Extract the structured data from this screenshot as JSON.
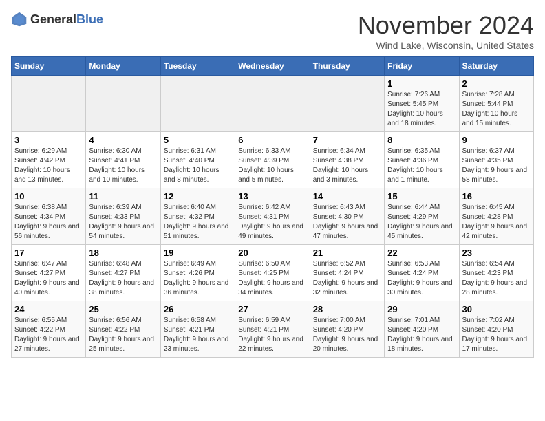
{
  "logo": {
    "text_general": "General",
    "text_blue": "Blue"
  },
  "title": "November 2024",
  "location": "Wind Lake, Wisconsin, United States",
  "days_header": [
    "Sunday",
    "Monday",
    "Tuesday",
    "Wednesday",
    "Thursday",
    "Friday",
    "Saturday"
  ],
  "weeks": [
    [
      {
        "day": "",
        "info": ""
      },
      {
        "day": "",
        "info": ""
      },
      {
        "day": "",
        "info": ""
      },
      {
        "day": "",
        "info": ""
      },
      {
        "day": "",
        "info": ""
      },
      {
        "day": "1",
        "info": "Sunrise: 7:26 AM\nSunset: 5:45 PM\nDaylight: 10 hours and 18 minutes."
      },
      {
        "day": "2",
        "info": "Sunrise: 7:28 AM\nSunset: 5:44 PM\nDaylight: 10 hours and 15 minutes."
      }
    ],
    [
      {
        "day": "3",
        "info": "Sunrise: 6:29 AM\nSunset: 4:42 PM\nDaylight: 10 hours and 13 minutes."
      },
      {
        "day": "4",
        "info": "Sunrise: 6:30 AM\nSunset: 4:41 PM\nDaylight: 10 hours and 10 minutes."
      },
      {
        "day": "5",
        "info": "Sunrise: 6:31 AM\nSunset: 4:40 PM\nDaylight: 10 hours and 8 minutes."
      },
      {
        "day": "6",
        "info": "Sunrise: 6:33 AM\nSunset: 4:39 PM\nDaylight: 10 hours and 5 minutes."
      },
      {
        "day": "7",
        "info": "Sunrise: 6:34 AM\nSunset: 4:38 PM\nDaylight: 10 hours and 3 minutes."
      },
      {
        "day": "8",
        "info": "Sunrise: 6:35 AM\nSunset: 4:36 PM\nDaylight: 10 hours and 1 minute."
      },
      {
        "day": "9",
        "info": "Sunrise: 6:37 AM\nSunset: 4:35 PM\nDaylight: 9 hours and 58 minutes."
      }
    ],
    [
      {
        "day": "10",
        "info": "Sunrise: 6:38 AM\nSunset: 4:34 PM\nDaylight: 9 hours and 56 minutes."
      },
      {
        "day": "11",
        "info": "Sunrise: 6:39 AM\nSunset: 4:33 PM\nDaylight: 9 hours and 54 minutes."
      },
      {
        "day": "12",
        "info": "Sunrise: 6:40 AM\nSunset: 4:32 PM\nDaylight: 9 hours and 51 minutes."
      },
      {
        "day": "13",
        "info": "Sunrise: 6:42 AM\nSunset: 4:31 PM\nDaylight: 9 hours and 49 minutes."
      },
      {
        "day": "14",
        "info": "Sunrise: 6:43 AM\nSunset: 4:30 PM\nDaylight: 9 hours and 47 minutes."
      },
      {
        "day": "15",
        "info": "Sunrise: 6:44 AM\nSunset: 4:29 PM\nDaylight: 9 hours and 45 minutes."
      },
      {
        "day": "16",
        "info": "Sunrise: 6:45 AM\nSunset: 4:28 PM\nDaylight: 9 hours and 42 minutes."
      }
    ],
    [
      {
        "day": "17",
        "info": "Sunrise: 6:47 AM\nSunset: 4:27 PM\nDaylight: 9 hours and 40 minutes."
      },
      {
        "day": "18",
        "info": "Sunrise: 6:48 AM\nSunset: 4:27 PM\nDaylight: 9 hours and 38 minutes."
      },
      {
        "day": "19",
        "info": "Sunrise: 6:49 AM\nSunset: 4:26 PM\nDaylight: 9 hours and 36 minutes."
      },
      {
        "day": "20",
        "info": "Sunrise: 6:50 AM\nSunset: 4:25 PM\nDaylight: 9 hours and 34 minutes."
      },
      {
        "day": "21",
        "info": "Sunrise: 6:52 AM\nSunset: 4:24 PM\nDaylight: 9 hours and 32 minutes."
      },
      {
        "day": "22",
        "info": "Sunrise: 6:53 AM\nSunset: 4:24 PM\nDaylight: 9 hours and 30 minutes."
      },
      {
        "day": "23",
        "info": "Sunrise: 6:54 AM\nSunset: 4:23 PM\nDaylight: 9 hours and 28 minutes."
      }
    ],
    [
      {
        "day": "24",
        "info": "Sunrise: 6:55 AM\nSunset: 4:22 PM\nDaylight: 9 hours and 27 minutes."
      },
      {
        "day": "25",
        "info": "Sunrise: 6:56 AM\nSunset: 4:22 PM\nDaylight: 9 hours and 25 minutes."
      },
      {
        "day": "26",
        "info": "Sunrise: 6:58 AM\nSunset: 4:21 PM\nDaylight: 9 hours and 23 minutes."
      },
      {
        "day": "27",
        "info": "Sunrise: 6:59 AM\nSunset: 4:21 PM\nDaylight: 9 hours and 22 minutes."
      },
      {
        "day": "28",
        "info": "Sunrise: 7:00 AM\nSunset: 4:20 PM\nDaylight: 9 hours and 20 minutes."
      },
      {
        "day": "29",
        "info": "Sunrise: 7:01 AM\nSunset: 4:20 PM\nDaylight: 9 hours and 18 minutes."
      },
      {
        "day": "30",
        "info": "Sunrise: 7:02 AM\nSunset: 4:20 PM\nDaylight: 9 hours and 17 minutes."
      }
    ]
  ]
}
